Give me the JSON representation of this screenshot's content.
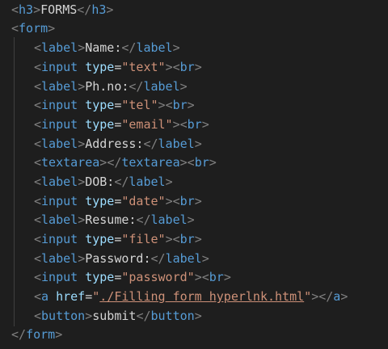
{
  "code": {
    "lines": [
      {
        "tokens": [
          {
            "k": "b",
            "v": "<"
          },
          {
            "k": "t",
            "v": "h3"
          },
          {
            "k": "b",
            "v": ">"
          },
          {
            "k": "x",
            "v": "FORMS"
          },
          {
            "k": "b",
            "v": "</"
          },
          {
            "k": "t",
            "v": "h3"
          },
          {
            "k": "b",
            "v": ">"
          }
        ]
      },
      {
        "tokens": [
          {
            "k": "b",
            "v": "<"
          },
          {
            "k": "t",
            "v": "form"
          },
          {
            "k": "b",
            "v": ">"
          }
        ]
      },
      {
        "tokens": [
          {
            "k": "b",
            "v": "<"
          },
          {
            "k": "t",
            "v": "label"
          },
          {
            "k": "b",
            "v": ">"
          },
          {
            "k": "x",
            "v": "Name:"
          },
          {
            "k": "b",
            "v": "</"
          },
          {
            "k": "t",
            "v": "label"
          },
          {
            "k": "b",
            "v": ">"
          }
        ]
      },
      {
        "tokens": [
          {
            "k": "b",
            "v": "<"
          },
          {
            "k": "t",
            "v": "input"
          },
          {
            "k": "o",
            "v": " "
          },
          {
            "k": "a",
            "v": "type"
          },
          {
            "k": "o",
            "v": "="
          },
          {
            "k": "s",
            "v": "\"text\""
          },
          {
            "k": "b",
            "v": ">"
          },
          {
            "k": "b",
            "v": "<"
          },
          {
            "k": "t",
            "v": "br"
          },
          {
            "k": "b",
            "v": ">"
          }
        ]
      },
      {
        "tokens": [
          {
            "k": "b",
            "v": "<"
          },
          {
            "k": "t",
            "v": "label"
          },
          {
            "k": "b",
            "v": ">"
          },
          {
            "k": "x",
            "v": "Ph.no:"
          },
          {
            "k": "b",
            "v": "</"
          },
          {
            "k": "t",
            "v": "label"
          },
          {
            "k": "b",
            "v": ">"
          }
        ]
      },
      {
        "tokens": [
          {
            "k": "b",
            "v": "<"
          },
          {
            "k": "t",
            "v": "input"
          },
          {
            "k": "o",
            "v": " "
          },
          {
            "k": "a",
            "v": "type"
          },
          {
            "k": "o",
            "v": "="
          },
          {
            "k": "s",
            "v": "\"tel\""
          },
          {
            "k": "b",
            "v": ">"
          },
          {
            "k": "b",
            "v": "<"
          },
          {
            "k": "t",
            "v": "br"
          },
          {
            "k": "b",
            "v": ">"
          }
        ]
      },
      {
        "tokens": [
          {
            "k": "b",
            "v": "<"
          },
          {
            "k": "t",
            "v": "input"
          },
          {
            "k": "o",
            "v": " "
          },
          {
            "k": "a",
            "v": "type"
          },
          {
            "k": "o",
            "v": "="
          },
          {
            "k": "s",
            "v": "\"email\""
          },
          {
            "k": "b",
            "v": ">"
          },
          {
            "k": "b",
            "v": "<"
          },
          {
            "k": "t",
            "v": "br"
          },
          {
            "k": "b",
            "v": ">"
          }
        ]
      },
      {
        "tokens": [
          {
            "k": "b",
            "v": "<"
          },
          {
            "k": "t",
            "v": "label"
          },
          {
            "k": "b",
            "v": ">"
          },
          {
            "k": "x",
            "v": "Address:"
          },
          {
            "k": "b",
            "v": "</"
          },
          {
            "k": "t",
            "v": "label"
          },
          {
            "k": "b",
            "v": ">"
          }
        ]
      },
      {
        "tokens": [
          {
            "k": "b",
            "v": "<"
          },
          {
            "k": "t",
            "v": "textarea"
          },
          {
            "k": "b",
            "v": ">"
          },
          {
            "k": "b",
            "v": "</"
          },
          {
            "k": "t",
            "v": "textarea"
          },
          {
            "k": "b",
            "v": ">"
          },
          {
            "k": "b",
            "v": "<"
          },
          {
            "k": "t",
            "v": "br"
          },
          {
            "k": "b",
            "v": ">"
          }
        ]
      },
      {
        "tokens": [
          {
            "k": "b",
            "v": "<"
          },
          {
            "k": "t",
            "v": "label"
          },
          {
            "k": "b",
            "v": ">"
          },
          {
            "k": "x",
            "v": "DOB:"
          },
          {
            "k": "b",
            "v": "</"
          },
          {
            "k": "t",
            "v": "label"
          },
          {
            "k": "b",
            "v": ">"
          }
        ]
      },
      {
        "tokens": [
          {
            "k": "b",
            "v": "<"
          },
          {
            "k": "t",
            "v": "input"
          },
          {
            "k": "o",
            "v": " "
          },
          {
            "k": "a",
            "v": "type"
          },
          {
            "k": "o",
            "v": "="
          },
          {
            "k": "s",
            "v": "\"date\""
          },
          {
            "k": "b",
            "v": ">"
          },
          {
            "k": "b",
            "v": "<"
          },
          {
            "k": "t",
            "v": "br"
          },
          {
            "k": "b",
            "v": ">"
          }
        ]
      },
      {
        "tokens": [
          {
            "k": "b",
            "v": "<"
          },
          {
            "k": "t",
            "v": "label"
          },
          {
            "k": "b",
            "v": ">"
          },
          {
            "k": "x",
            "v": "Resume:"
          },
          {
            "k": "b",
            "v": "</"
          },
          {
            "k": "t",
            "v": "label"
          },
          {
            "k": "b",
            "v": ">"
          }
        ]
      },
      {
        "tokens": [
          {
            "k": "b",
            "v": "<"
          },
          {
            "k": "t",
            "v": "input"
          },
          {
            "k": "o",
            "v": " "
          },
          {
            "k": "a",
            "v": "type"
          },
          {
            "k": "o",
            "v": "="
          },
          {
            "k": "s",
            "v": "\"file\""
          },
          {
            "k": "b",
            "v": ">"
          },
          {
            "k": "b",
            "v": "<"
          },
          {
            "k": "t",
            "v": "br"
          },
          {
            "k": "b",
            "v": ">"
          }
        ]
      },
      {
        "tokens": [
          {
            "k": "b",
            "v": "<"
          },
          {
            "k": "t",
            "v": "label"
          },
          {
            "k": "b",
            "v": ">"
          },
          {
            "k": "x",
            "v": "Password:"
          },
          {
            "k": "b",
            "v": "</"
          },
          {
            "k": "t",
            "v": "label"
          },
          {
            "k": "b",
            "v": ">"
          }
        ]
      },
      {
        "tokens": [
          {
            "k": "b",
            "v": "<"
          },
          {
            "k": "t",
            "v": "input"
          },
          {
            "k": "o",
            "v": " "
          },
          {
            "k": "a",
            "v": "type"
          },
          {
            "k": "o",
            "v": "="
          },
          {
            "k": "s",
            "v": "\"password\""
          },
          {
            "k": "b",
            "v": ">"
          },
          {
            "k": "b",
            "v": "<"
          },
          {
            "k": "t",
            "v": "br"
          },
          {
            "k": "b",
            "v": ">"
          }
        ]
      },
      {
        "tokens": [
          {
            "k": "b",
            "v": "<"
          },
          {
            "k": "t",
            "v": "a"
          },
          {
            "k": "o",
            "v": " "
          },
          {
            "k": "a",
            "v": "href"
          },
          {
            "k": "o",
            "v": "="
          },
          {
            "k": "s",
            "v": "\""
          },
          {
            "k": "s link",
            "v": "./Filling form hyperlnk.html"
          },
          {
            "k": "s",
            "v": "\""
          },
          {
            "k": "b",
            "v": ">"
          },
          {
            "k": "b",
            "v": "</"
          },
          {
            "k": "t",
            "v": "a"
          },
          {
            "k": "b",
            "v": ">"
          }
        ]
      },
      {
        "tokens": [
          {
            "k": "b",
            "v": "<"
          },
          {
            "k": "t",
            "v": "button"
          },
          {
            "k": "b",
            "v": ">"
          },
          {
            "k": "x",
            "v": "submit"
          },
          {
            "k": "b",
            "v": "</"
          },
          {
            "k": "t",
            "v": "button"
          },
          {
            "k": "b",
            "v": ">"
          }
        ]
      },
      {
        "tokens": [
          {
            "k": "b",
            "v": "</"
          },
          {
            "k": "t",
            "v": "form"
          },
          {
            "k": "b",
            "v": ">"
          }
        ]
      }
    ]
  },
  "theme": {
    "background": "#1e1e1e",
    "tag_bracket": "#808080",
    "tag_name": "#569cd6",
    "attribute": "#9cdcfe",
    "string": "#ce9178",
    "text": "#d4d4d4"
  }
}
